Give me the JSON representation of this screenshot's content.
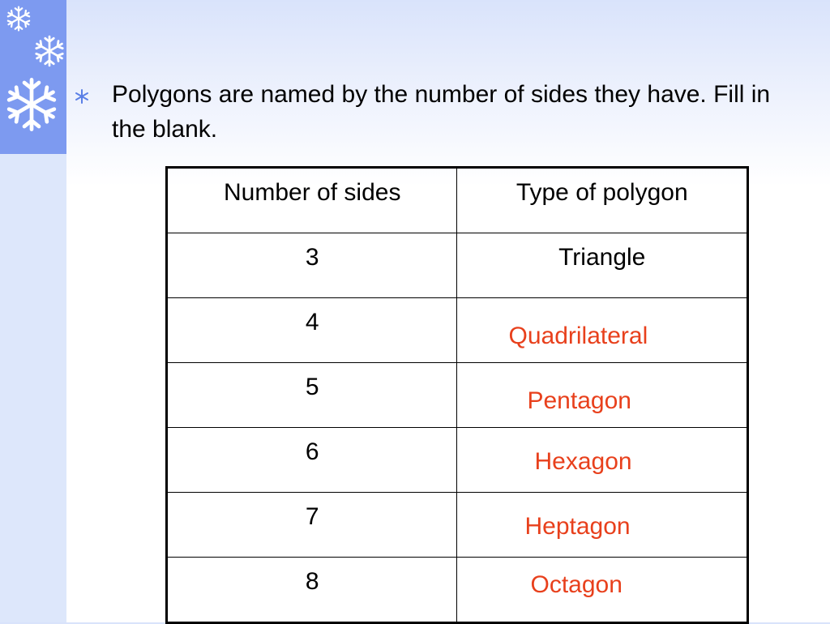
{
  "slide": {
    "bullet_text": "Polygons are named by the number of sides they have.  Fill in the blank.",
    "accent_color": "#e8401c",
    "decoration_icon": "snowflake-icon"
  },
  "table": {
    "headers": [
      "Number of sides",
      "Type of polygon"
    ],
    "rows": [
      {
        "sides": "3",
        "type": "Triangle",
        "answer": ""
      },
      {
        "sides": "4",
        "type": "",
        "answer": "Quadrilateral"
      },
      {
        "sides": "5",
        "type": "",
        "answer": "Pentagon"
      },
      {
        "sides": "6",
        "type": "",
        "answer": "Hexagon"
      },
      {
        "sides": "7",
        "type": "",
        "answer": "Heptagon"
      },
      {
        "sides": "8",
        "type": "",
        "answer": "Octagon"
      }
    ]
  }
}
